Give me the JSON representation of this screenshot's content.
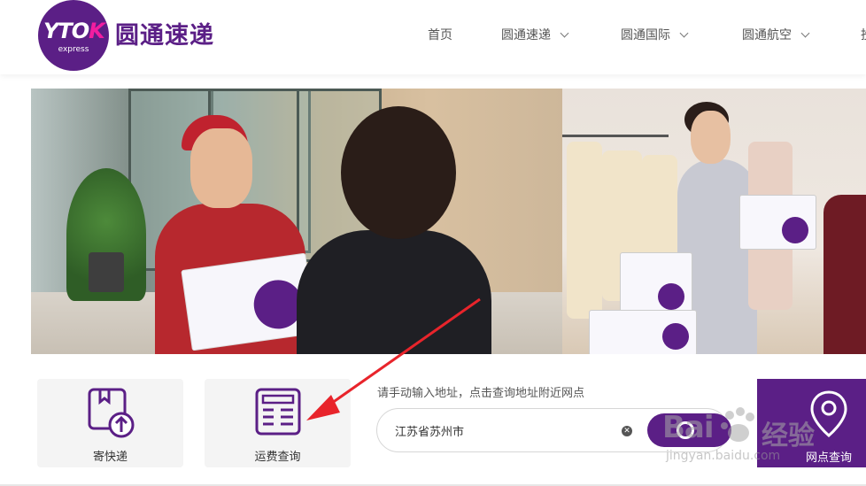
{
  "brand": {
    "logo_mark": "YTO",
    "logo_k": "K",
    "logo_sub": "express",
    "name": "圆通速递",
    "color": "#5b1f86"
  },
  "nav": {
    "items": [
      {
        "label": "首页",
        "dropdown": false
      },
      {
        "label": "圆通速递",
        "dropdown": true
      },
      {
        "label": "圆通国际",
        "dropdown": true
      },
      {
        "label": "圆通航空",
        "dropdown": true
      },
      {
        "label": "投",
        "dropdown": false
      }
    ]
  },
  "services": {
    "send": {
      "label": "寄快递",
      "icon": "package-upload-icon"
    },
    "fee": {
      "label": "运费查询",
      "icon": "calculator-icon"
    }
  },
  "branch_search": {
    "hint": "请手动输入地址，点击查询地址附近网点",
    "value": "江苏省苏州市",
    "clear_icon": "clear-icon",
    "search_icon": "search-icon"
  },
  "branch_card": {
    "label": "网点查询",
    "icon": "location-pin-icon"
  },
  "watermark": {
    "brand": "Bai",
    "brand_cn": "经验",
    "url": "jingyan.baidu.com"
  },
  "annotation": {
    "arrow_color": "#e8242b"
  }
}
